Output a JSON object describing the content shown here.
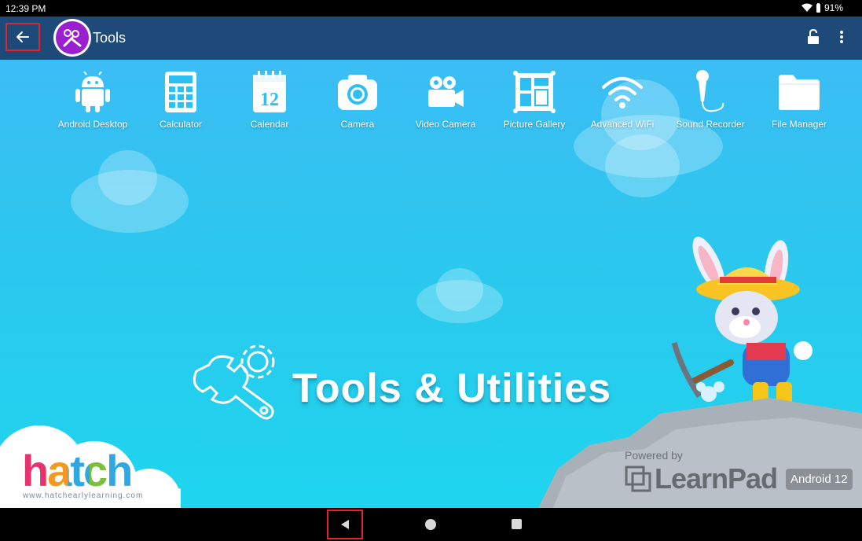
{
  "status_bar": {
    "time": "12:39 PM",
    "battery": "91%"
  },
  "app_bar": {
    "title": "Tools"
  },
  "apps": [
    {
      "label": "Android Desktop",
      "icon": "android-icon"
    },
    {
      "label": "Calculator",
      "icon": "calculator-icon"
    },
    {
      "label": "Calendar",
      "icon": "calendar-icon",
      "day": "12"
    },
    {
      "label": "Camera",
      "icon": "camera-icon"
    },
    {
      "label": "Video Camera",
      "icon": "video-camera-icon"
    },
    {
      "label": "Picture Gallery",
      "icon": "picture-gallery-icon"
    },
    {
      "label": "Advanced WiFi",
      "icon": "wifi-icon"
    },
    {
      "label": "Sound Recorder",
      "icon": "microphone-icon"
    },
    {
      "label": "File Manager",
      "icon": "folder-icon"
    }
  ],
  "banner": {
    "title": "Tools & Utilities"
  },
  "branding": {
    "hatch_logo": "hatch",
    "hatch_url": "www.hatchearlylearning.com",
    "powered_by": "Powered by",
    "learnpad": "LearnPad",
    "android_version": "Android 12"
  },
  "colors": {
    "app_bar": "#1e4a7a",
    "accent": "#9b1fd1",
    "highlight": "#e0242b"
  }
}
